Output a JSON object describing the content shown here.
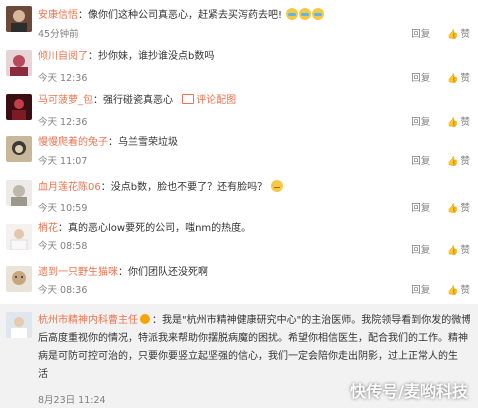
{
  "comments": [
    {
      "name": "安康信悟",
      "text": "：像你们这种公司真恶心，赶紧去买泻药去吧!",
      "time": "45分钟前",
      "reply": "回复",
      "like": "赞",
      "emoji_count": 3
    },
    {
      "name": "倾川自阅了",
      "text": "：抄你妹，谁抄谁没点b数吗",
      "time": "今天 12:36",
      "reply": "回复",
      "like": "赞"
    },
    {
      "name": "马可菠萝_包",
      "text": "：强行碰瓷真恶心",
      "pic_label": "评论配图",
      "time": "今天 12:36",
      "reply": "回复",
      "like": "赞"
    },
    {
      "name": "慢慢爬着的兔子",
      "text": "：乌兰雪荣垃圾",
      "time": "今天 11:07",
      "reply": "回复",
      "like": "赞"
    },
    {
      "name": "血月莲花陈06",
      "text": "：没点b数，脸也不要了？还有脸吗？",
      "time": "今天 10:59",
      "reply": "回复",
      "like": "赞"
    },
    {
      "name": "梢花",
      "text": "：真的恶心low要死的公司，嗤nm的热度。",
      "time": "今天 08:58",
      "reply": "回复",
      "like": "赞"
    },
    {
      "name": "遗到一只野生猫咪",
      "text": "：你们团队还没死啊",
      "time": "今天 08:36",
      "reply": "回复",
      "like": "赞"
    },
    {
      "name": "杭州市精神内科曹主任",
      "line1": "：我是\"杭州市精神健康研究中心\"的主治医师。我院领导看到你发的微博",
      "line2": "后高度重视你的情况，特派我来帮助你摆脱病魔的困扰。希望你相信医生，配合我们的工作。精神",
      "line3": "病是可防可控可治的，只要你要竖立起坚强的信心，我们一定会陪你走出阴影，过上正常人的生",
      "line4": "活",
      "time": "8月23日 11:24"
    }
  ],
  "watermark": "快传号/麦哟科技",
  "colors": {
    "name": "#eb7350",
    "meta": "#808080",
    "emoji": "#f7c844"
  }
}
